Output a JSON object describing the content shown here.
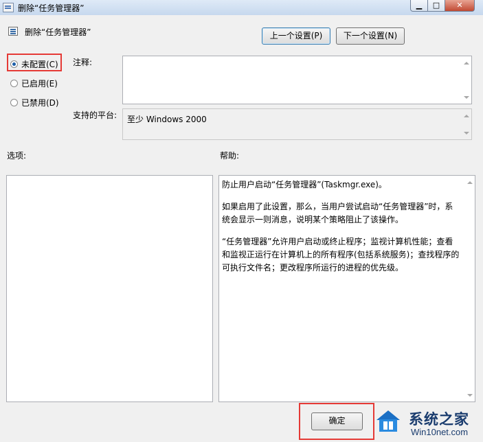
{
  "window": {
    "title": "删除“任务管理器”",
    "controls": {
      "minimize": "▁",
      "maximize": "□",
      "close": "✕"
    }
  },
  "policy": {
    "name": "删除“任务管理器”"
  },
  "nav": {
    "prev_setting": "上一个设置(P)",
    "next_setting": "下一个设置(N)"
  },
  "state_options": [
    {
      "label": "未配置(C)",
      "selected": true
    },
    {
      "label": "已启用(E)",
      "selected": false
    },
    {
      "label": "已禁用(D)",
      "selected": false
    }
  ],
  "comment": {
    "label": "注释:",
    "value": ""
  },
  "platform": {
    "label": "支持的平台:",
    "value": "至少 Windows 2000"
  },
  "options": {
    "label": "选项:"
  },
  "help": {
    "label": "帮助:",
    "paragraphs": [
      "防止用户启动“任务管理器”(Taskmgr.exe)。",
      "如果启用了此设置，那么，当用户尝试启动“任务管理器”时，系统会显示一则消息，说明某个策略阻止了该操作。",
      "“任务管理器”允许用户启动或终止程序；监视计算机性能；查看和监视正运行在计算机上的所有程序(包括系统服务)；查找程序的可执行文件名；更改程序所运行的进程的优先级。"
    ]
  },
  "footer": {
    "ok_label": "确定"
  },
  "watermark": {
    "line1": "系统之家",
    "line2": "Win10net.com"
  },
  "colors": {
    "highlight_box": "#e53935",
    "radio_selected": "#1e5fa8"
  }
}
